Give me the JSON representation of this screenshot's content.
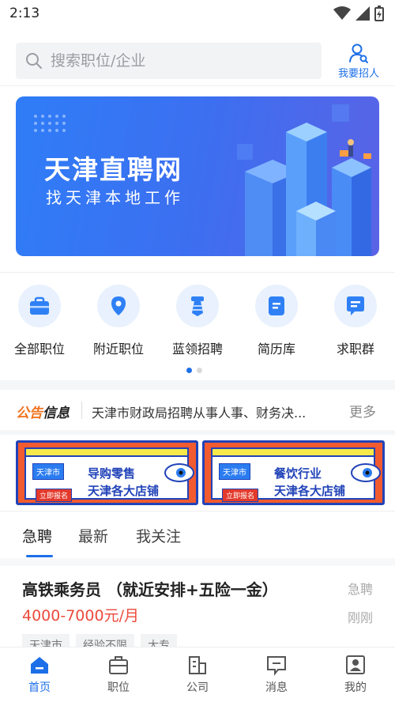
{
  "status_bar": {
    "time": "2:13"
  },
  "search": {
    "placeholder": "搜索职位/企业",
    "recruit_label": "我要招人"
  },
  "banner": {
    "title": "天津直聘网",
    "subtitle": "找天津本地工作"
  },
  "quick_menu": [
    {
      "label": "全部职位",
      "icon": "briefcase-icon"
    },
    {
      "label": "附近职位",
      "icon": "location-pin-icon"
    },
    {
      "label": "蓝领招聘",
      "icon": "tie-icon"
    },
    {
      "label": "简历库",
      "icon": "resume-icon"
    },
    {
      "label": "求职群",
      "icon": "chat-group-icon"
    }
  ],
  "pager": {
    "count": 2,
    "active": 1
  },
  "notice": {
    "brand_part1": "公告",
    "brand_part2": "信息",
    "text": "天津市财政局招聘从事人事、财务决...",
    "more": "更多"
  },
  "promos": [
    {
      "city": "天津市",
      "apply": "立即报名",
      "line1": "导购零售",
      "line2": "天津各大店铺"
    },
    {
      "city": "天津市",
      "apply": "立即报名",
      "line1": "餐饮行业",
      "line2": "天津各大店铺"
    }
  ],
  "tabs": [
    {
      "label": "急聘"
    },
    {
      "label": "最新"
    },
    {
      "label": "我关注"
    }
  ],
  "job": {
    "title": "高铁乘务员 （就近安排+五险一金）",
    "salary": "4000-7000元/月",
    "badge": "急聘",
    "time": "刚刚",
    "tags": [
      "天津市",
      "经验不限",
      "大专"
    ]
  },
  "bottom_nav": [
    {
      "label": "首页",
      "icon": "home-icon"
    },
    {
      "label": "职位",
      "icon": "briefcase-icon"
    },
    {
      "label": "公司",
      "icon": "building-icon"
    },
    {
      "label": "消息",
      "icon": "message-icon"
    },
    {
      "label": "我的",
      "icon": "profile-icon"
    }
  ],
  "colors": {
    "accent": "#1d6fe8",
    "salary": "#ec4a3b",
    "notice_brand": "#f0731e"
  }
}
